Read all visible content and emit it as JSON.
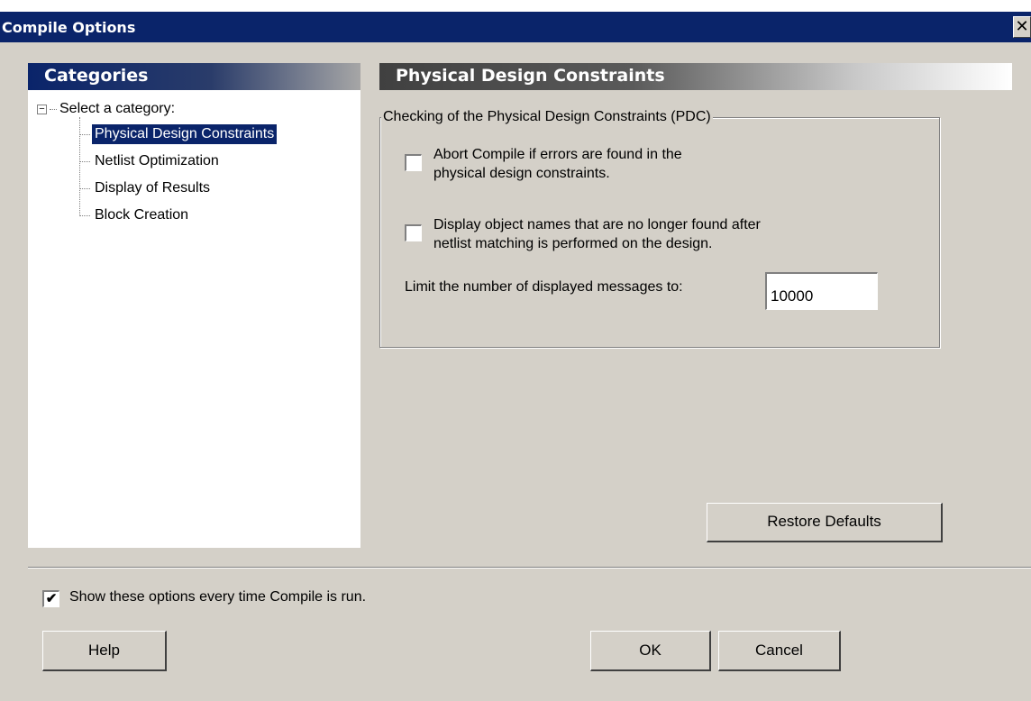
{
  "window": {
    "title": "Compile Options",
    "close_glyph": "✕"
  },
  "categories": {
    "header": "Categories",
    "root_label": "Select a category:",
    "root_toggle": "−",
    "items": [
      {
        "label": "Physical Design Constraints",
        "selected": true
      },
      {
        "label": "Netlist Optimization",
        "selected": false
      },
      {
        "label": "Display of Results",
        "selected": false
      },
      {
        "label": "Block Creation",
        "selected": false
      }
    ]
  },
  "panel": {
    "header": "Physical Design Constraints",
    "group_title": "Checking of the Physical Design Constraints (PDC)",
    "options": [
      {
        "line1": "Abort Compile if errors are found in the",
        "line2": "physical design constraints.",
        "checked": false
      },
      {
        "line1": "Display object names that are no longer found after",
        "line2": "netlist matching is performed on the design.",
        "checked": false
      }
    ],
    "limit_label": "Limit the number of displayed messages to:",
    "limit_value": "10000",
    "restore_label": "Restore Defaults"
  },
  "footer": {
    "show_options_label": "Show these options every time Compile is run.",
    "show_options_checked": true,
    "check_glyph": "✔",
    "help_label": "Help",
    "ok_label": "OK",
    "cancel_label": "Cancel"
  }
}
